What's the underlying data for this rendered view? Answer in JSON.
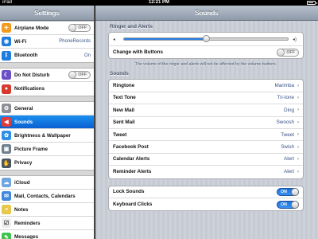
{
  "status": {
    "carrier": "iPad",
    "time": "12:21 PM",
    "battery_level": 0.9
  },
  "sidebar": {
    "title": "Settings",
    "groups": [
      [
        {
          "label": "Airplane Mode",
          "icon": "airplane-icon",
          "icon_color": "#f29a1b",
          "toggle": "OFF"
        },
        {
          "label": "Wi-Fi",
          "icon": "wifi-icon",
          "icon_color": "#1e7de0",
          "value": "PhoneRecords"
        },
        {
          "label": "Bluetooth",
          "icon": "bluetooth-icon",
          "icon_color": "#1e7de0",
          "value": "On"
        }
      ],
      [
        {
          "label": "Do Not Disturb",
          "icon": "moon-icon",
          "icon_color": "#6b4fc7",
          "toggle": "OFF"
        },
        {
          "label": "Notifications",
          "icon": "notifications-icon",
          "icon_color": "#d63a2e"
        }
      ],
      [
        {
          "label": "General",
          "icon": "gear-icon",
          "icon_color": "#8c8f95"
        },
        {
          "label": "Sounds",
          "icon": "speaker-icon",
          "icon_color": "#e13b3b",
          "selected": true
        },
        {
          "label": "Brightness & Wallpaper",
          "icon": "flower-icon",
          "icon_color": "#2d8ee6"
        },
        {
          "label": "Picture Frame",
          "icon": "picture-frame-icon",
          "icon_color": "#6e7f8e"
        },
        {
          "label": "Privacy",
          "icon": "hand-icon",
          "icon_color": "#4a5562"
        }
      ],
      [
        {
          "label": "iCloud",
          "icon": "cloud-icon",
          "icon_color": "#6fa5e0"
        },
        {
          "label": "Mail, Contacts, Calendars",
          "icon": "mail-icon",
          "icon_color": "#3f86de"
        },
        {
          "label": "Notes",
          "icon": "notes-icon",
          "icon_color": "#e6c84b"
        },
        {
          "label": "Reminders",
          "icon": "reminders-icon",
          "icon_color": "#ededed"
        },
        {
          "label": "Messages",
          "icon": "messages-icon",
          "icon_color": "#3cc44c"
        }
      ]
    ]
  },
  "content": {
    "title": "Sounds",
    "ringer_section": "Ringer and Alerts",
    "volume_level": 0.5,
    "change_with_buttons": {
      "label": "Change with Buttons",
      "toggle": "OFF"
    },
    "note": "The volume of the ringer and alerts will not be affected by the volume buttons.",
    "sounds_section": "Sounds",
    "sounds": [
      {
        "label": "Ringtone",
        "value": "Marimba"
      },
      {
        "label": "Text Tone",
        "value": "Tri-tone"
      },
      {
        "label": "New Mail",
        "value": "Ding"
      },
      {
        "label": "Sent Mail",
        "value": "Swoosh"
      },
      {
        "label": "Tweet",
        "value": "Tweet"
      },
      {
        "label": "Facebook Post",
        "value": "Swish"
      },
      {
        "label": "Calendar Alerts",
        "value": "Alert"
      },
      {
        "label": "Reminder Alerts",
        "value": "Alert"
      }
    ],
    "toggles": [
      {
        "label": "Lock Sounds",
        "toggle": "ON"
      },
      {
        "label": "Keyboard Clicks",
        "toggle": "ON"
      }
    ],
    "chevron": "›"
  }
}
